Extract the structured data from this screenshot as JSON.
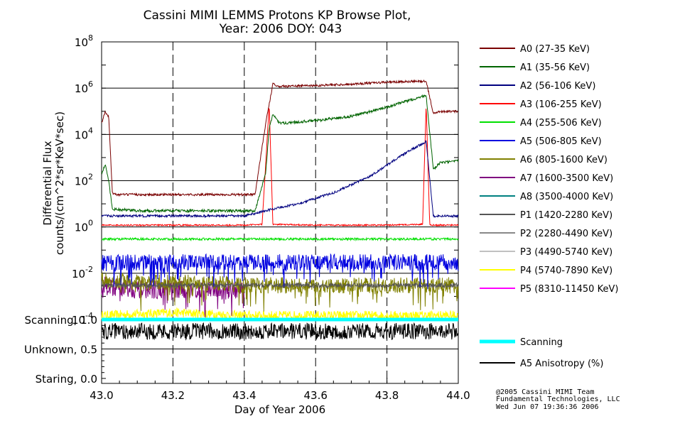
{
  "chart_data": {
    "type": "line",
    "title": "Cassini MIMI LEMMS Protons KP Browse Plot,",
    "subtitle": "Year: 2006 DOY: 043",
    "xlabel": "Day of Year 2006",
    "ylabel_line1": "Differential Flux",
    "ylabel_line2": "counts/(cm^2*sr*KeV*sec)",
    "xlim": [
      43.0,
      44.0
    ],
    "x_ticks": [
      "43.0",
      "43.2",
      "43.4",
      "43.6",
      "43.8",
      "44.0"
    ],
    "x_tick_values": [
      43.0,
      43.2,
      43.4,
      43.6,
      43.8,
      44.0
    ],
    "ylim": [
      0.0001,
      100000000
    ],
    "yscale": "log",
    "y_ticks": [
      {
        "base": "10",
        "exp": "8",
        "value": 100000000
      },
      {
        "base": "10",
        "exp": "6",
        "value": 1000000
      },
      {
        "base": "10",
        "exp": "4",
        "value": 10000
      },
      {
        "base": "10",
        "exp": "2",
        "value": 100
      },
      {
        "base": "10",
        "exp": "0",
        "value": 1
      },
      {
        "base": "10",
        "exp": "-2",
        "value": 0.01
      },
      {
        "base": "10",
        "exp": "-4",
        "value": 0.0001
      }
    ],
    "series": [
      {
        "name": "A0 (27-35 KeV)",
        "color": "#7a0000",
        "points": [
          [
            43.0,
            30000
          ],
          [
            43.01,
            100000
          ],
          [
            43.02,
            60000
          ],
          [
            43.03,
            30
          ],
          [
            43.04,
            25
          ],
          [
            43.1,
            25
          ],
          [
            43.2,
            25
          ],
          [
            43.3,
            25
          ],
          [
            43.43,
            25
          ],
          [
            43.46,
            30000
          ],
          [
            43.47,
            200000
          ],
          [
            43.48,
            1500000
          ],
          [
            43.5,
            1200000
          ],
          [
            43.6,
            1300000
          ],
          [
            43.7,
            1500000
          ],
          [
            43.8,
            1800000
          ],
          [
            43.91,
            2000000
          ],
          [
            43.93,
            80000
          ],
          [
            43.95,
            100000
          ],
          [
            44.0,
            100000
          ]
        ]
      },
      {
        "name": "A1 (35-56 KeV)",
        "color": "#006400",
        "points": [
          [
            43.0,
            200
          ],
          [
            43.01,
            500
          ],
          [
            43.02,
            100
          ],
          [
            43.03,
            6
          ],
          [
            43.1,
            5
          ],
          [
            43.2,
            5
          ],
          [
            43.3,
            5
          ],
          [
            43.43,
            5
          ],
          [
            43.46,
            200
          ],
          [
            43.47,
            20000
          ],
          [
            43.48,
            70000
          ],
          [
            43.5,
            30000
          ],
          [
            43.6,
            40000
          ],
          [
            43.7,
            60000
          ],
          [
            43.8,
            150000
          ],
          [
            43.91,
            500000
          ],
          [
            43.93,
            300
          ],
          [
            43.95,
            600
          ],
          [
            44.0,
            700
          ]
        ]
      },
      {
        "name": "A2 (56-106 KeV)",
        "color": "#000080",
        "points": [
          [
            43.0,
            3
          ],
          [
            43.1,
            3
          ],
          [
            43.2,
            3
          ],
          [
            43.3,
            3
          ],
          [
            43.4,
            3
          ],
          [
            43.48,
            6
          ],
          [
            43.55,
            10
          ],
          [
            43.65,
            30
          ],
          [
            43.75,
            150
          ],
          [
            43.85,
            1500
          ],
          [
            43.91,
            5000
          ],
          [
            43.93,
            3
          ],
          [
            44.0,
            3
          ]
        ]
      },
      {
        "name": "A3 (106-255 KeV)",
        "color": "#ff0000",
        "points": [
          [
            43.0,
            1.2
          ],
          [
            43.1,
            1.2
          ],
          [
            43.2,
            1.2
          ],
          [
            43.3,
            1.2
          ],
          [
            43.4,
            1.2
          ],
          [
            43.45,
            1.3
          ],
          [
            43.47,
            200000
          ],
          [
            43.48,
            1.3
          ],
          [
            43.6,
            1.2
          ],
          [
            43.7,
            1.2
          ],
          [
            43.8,
            1.2
          ],
          [
            43.9,
            1.3
          ],
          [
            43.91,
            200000
          ],
          [
            43.92,
            1.2
          ],
          [
            44.0,
            1.2
          ]
        ]
      },
      {
        "name": "A4 (255-506 KeV)",
        "color": "#00e000",
        "points": [
          [
            43.0,
            0.3
          ],
          [
            43.2,
            0.3
          ],
          [
            43.4,
            0.3
          ],
          [
            43.6,
            0.3
          ],
          [
            43.8,
            0.3
          ],
          [
            44.0,
            0.3
          ]
        ]
      },
      {
        "name": "A5 (506-805 KeV)",
        "color": "#0000e0",
        "points": [
          [
            43.0,
            0.03
          ],
          [
            43.2,
            0.03
          ],
          [
            43.4,
            0.03
          ],
          [
            43.6,
            0.03
          ],
          [
            43.8,
            0.03
          ],
          [
            44.0,
            0.03
          ]
        ]
      },
      {
        "name": "A6 (805-1600 KeV)",
        "color": "#808000",
        "points": [
          [
            43.0,
            0.005
          ],
          [
            43.1,
            0.004
          ],
          [
            43.2,
            0.004
          ],
          [
            43.3,
            0.004
          ],
          [
            43.4,
            0.003
          ],
          [
            44.0,
            0.003
          ]
        ]
      },
      {
        "name": "A7 (1600-3500 KeV)",
        "color": "#800080",
        "points": [
          [
            43.0,
            0.003
          ],
          [
            43.1,
            0.002
          ],
          [
            43.2,
            0.002
          ],
          [
            43.3,
            0.002
          ],
          [
            43.4,
            0.002
          ]
        ]
      },
      {
        "name": "A8 (3500-4000 KeV)",
        "color": "#008080",
        "points": [
          [
            43.0,
            0.003
          ],
          [
            43.2,
            0.003
          ],
          [
            43.4,
            0.003
          ],
          [
            43.6,
            0.003
          ],
          [
            43.8,
            0.003
          ],
          [
            44.0,
            0.003
          ]
        ]
      },
      {
        "name": "P1 (1420-2280 KeV)",
        "color": "#555555",
        "points": [
          [
            43.0,
            0.003
          ],
          [
            43.2,
            0.003
          ],
          [
            43.4,
            0.003
          ],
          [
            43.6,
            0.003
          ],
          [
            43.8,
            0.003
          ],
          [
            44.0,
            0.003
          ]
        ]
      },
      {
        "name": "P2 (2280-4490 KeV)",
        "color": "#888888",
        "points": [
          [
            43.0,
            0.003
          ],
          [
            44.0,
            0.003
          ]
        ]
      },
      {
        "name": "P3 (4490-5740 KeV)",
        "color": "#c0c0c0",
        "points": [
          [
            43.0,
            0.0002
          ],
          [
            44.0,
            0.0002
          ]
        ]
      },
      {
        "name": "P4 (5740-7890 KeV)",
        "color": "#ffff00",
        "points": [
          [
            43.0,
            0.00015
          ],
          [
            43.2,
            0.0002
          ],
          [
            43.4,
            0.00015
          ],
          [
            43.6,
            0.00015
          ],
          [
            43.8,
            0.00015
          ],
          [
            44.0,
            0.00015
          ]
        ]
      },
      {
        "name": "P5 (8310-11450 KeV)",
        "color": "#ff00ff",
        "points": [
          [
            43.0,
            0.0001
          ],
          [
            44.0,
            0.0001
          ]
        ]
      }
    ],
    "lower_panel": {
      "category_labels": [
        {
          "label": "Scanning, 1.0",
          "value": 1.0
        },
        {
          "label": "Unknown, 0.5",
          "value": 0.5
        },
        {
          "label": "Staring, 0.0",
          "value": 0.0
        }
      ],
      "ylim": [
        0.0,
        1.0
      ],
      "series": [
        {
          "name": "Scanning",
          "color": "#00ffff",
          "values_constant": 1.0
        },
        {
          "name": "A5 Anisotropy (%)",
          "color": "#000000",
          "level": 0.8
        }
      ]
    },
    "grid": true,
    "legend_placement": "right"
  },
  "credit": {
    "line1": "@2005 Cassini MIMI Team",
    "line2": "Fundamental Technologies, LLC",
    "line3": "Wed Jun 07 19:36:36 2006"
  }
}
